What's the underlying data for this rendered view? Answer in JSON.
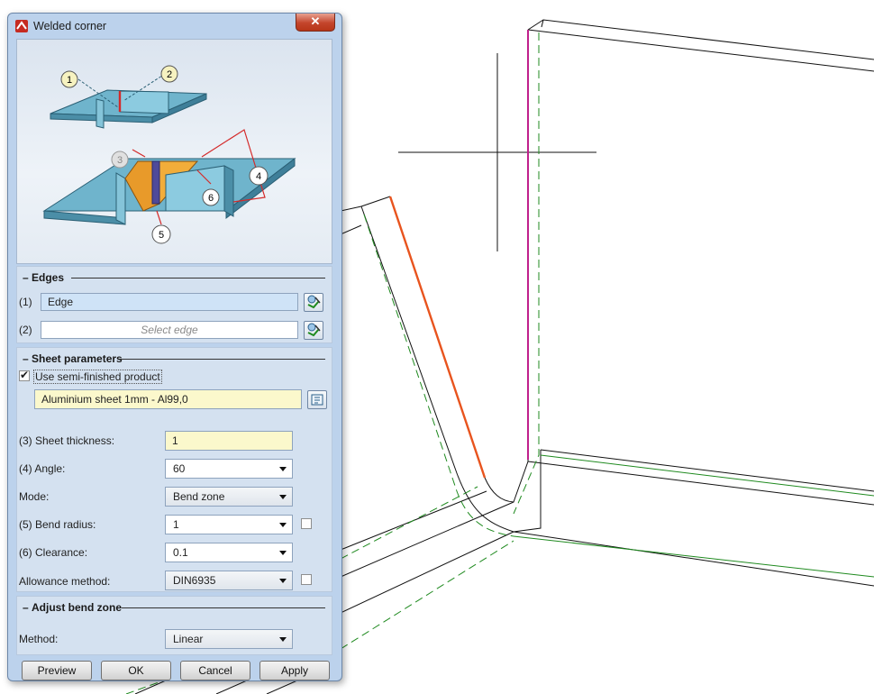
{
  "dialog": {
    "title": "Welded corner",
    "close_glyph": "✕"
  },
  "illustration": {
    "callouts": [
      "1",
      "2",
      "3",
      "4",
      "5",
      "6"
    ]
  },
  "edges": {
    "title": "Edges",
    "rows": [
      {
        "label": "(1)",
        "value": "Edge",
        "placeholder": ""
      },
      {
        "label": "(2)",
        "value": "",
        "placeholder": "Select edge"
      }
    ]
  },
  "sheet": {
    "title": "Sheet parameters",
    "semi_finished_label": "Use semi-finished product",
    "semi_finished_checked": true,
    "product": "Aluminium sheet 1mm - Al99,0",
    "fields": {
      "thickness": {
        "label": "(3) Sheet thickness:",
        "value": "1"
      },
      "angle": {
        "label": "(4) Angle:",
        "value": "60"
      },
      "mode": {
        "label": "Mode:",
        "value": "Bend zone"
      },
      "bend_radius": {
        "label": "(5) Bend radius:",
        "value": "1"
      },
      "clearance": {
        "label": "(6) Clearance:",
        "value": "0.1"
      },
      "allowance": {
        "label": "Allowance method:",
        "value": "DIN6935"
      }
    }
  },
  "adjust": {
    "title": "Adjust bend zone",
    "method_label": "Method:",
    "method_value": "Linear"
  },
  "buttons": {
    "preview": "Preview",
    "ok": "OK",
    "cancel": "Cancel",
    "apply": "Apply"
  },
  "colors": {
    "highlight_edge": "#e8541e",
    "selected_edge": "#c0208c",
    "guide_line": "#1f8a1f",
    "accent": "#bcd2ec"
  }
}
